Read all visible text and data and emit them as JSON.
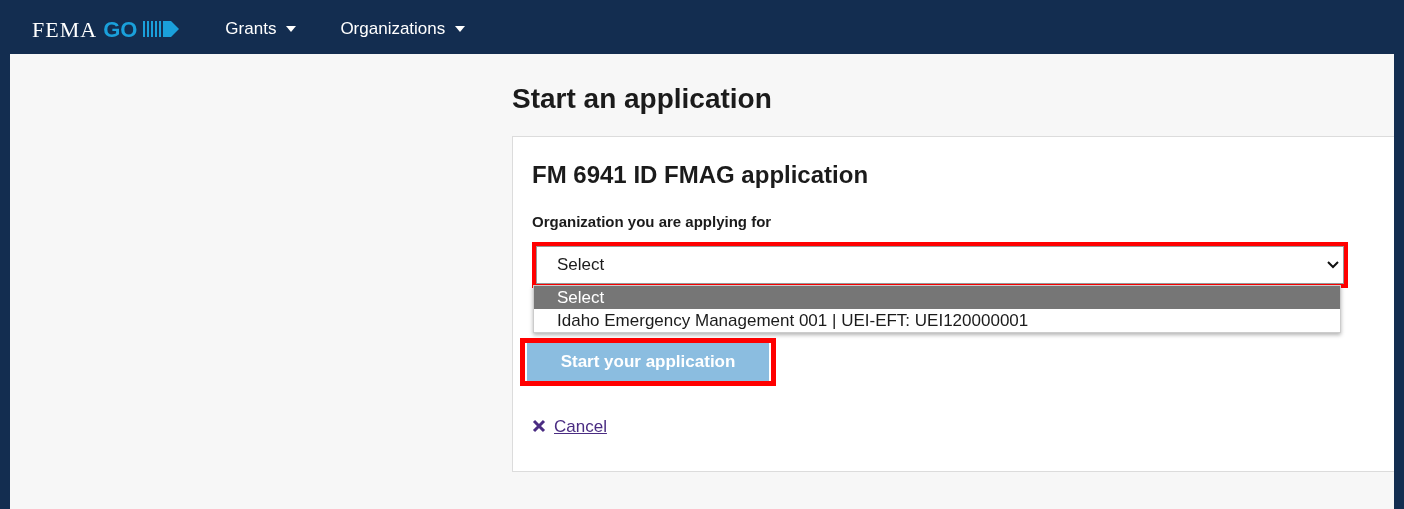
{
  "nav": {
    "logo": {
      "word": "FEMA",
      "accent": "GO"
    },
    "menus": [
      {
        "label": "Grants"
      },
      {
        "label": "Organizations"
      }
    ]
  },
  "page": {
    "title": "Start an application"
  },
  "card": {
    "title": "FM 6941 ID FMAG application",
    "field_label": "Organization you are applying for",
    "select": {
      "value": "Select",
      "expanded": true,
      "highlighted": true,
      "options": [
        {
          "label": "Select",
          "selected": true
        },
        {
          "label": "Idaho Emergency Management 001 | UEI-EFT: UEI120000001",
          "selected": false
        }
      ]
    },
    "start_button": {
      "label": "Start your application",
      "disabled": true,
      "highlighted": true
    },
    "cancel": {
      "label": "Cancel"
    }
  }
}
